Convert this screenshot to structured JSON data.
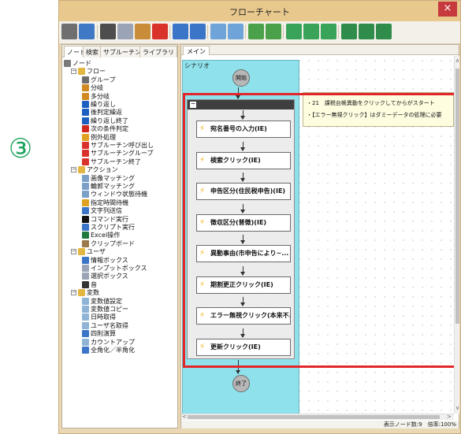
{
  "step_badge": "③",
  "window": {
    "title": "フローチャート",
    "close": "×"
  },
  "toolbar": {
    "buttons": [
      {
        "icon": "new-document-icon",
        "color": "#6f6f6f"
      },
      {
        "icon": "save-icon",
        "color": "#3f79c5"
      },
      {
        "icon": "cut-icon",
        "color": "#4d4d4d"
      },
      {
        "icon": "copy-icon",
        "color": "#9aa4b6"
      },
      {
        "icon": "paste-icon",
        "color": "#c98d3a"
      },
      {
        "icon": "delete-icon",
        "color": "#d9322b"
      },
      {
        "icon": "undo-icon",
        "color": "#3a75c8"
      },
      {
        "icon": "redo-icon",
        "color": "#3a75c8"
      },
      {
        "icon": "zoom-in-icon",
        "color": "#6ea4d8"
      },
      {
        "icon": "zoom-out-icon",
        "color": "#6ea4d8"
      },
      {
        "icon": "image-capture-icon",
        "color": "#4aa14a"
      },
      {
        "icon": "image-edit-icon",
        "color": "#4aa14a"
      },
      {
        "icon": "run-icon",
        "color": "#3aa35a"
      },
      {
        "icon": "export-icon",
        "color": "#3aa35a"
      },
      {
        "icon": "import-icon",
        "color": "#3aa35a"
      },
      {
        "icon": "window-icon",
        "color": "#2f8c4a"
      },
      {
        "icon": "window-import-icon",
        "color": "#2f8c4a"
      },
      {
        "icon": "window-export-icon",
        "color": "#2f8c4a"
      }
    ]
  },
  "left_tabs": [
    "ノード",
    "検索",
    "サブルーチン",
    "ライブラリ"
  ],
  "tree": [
    {
      "label": "ノード",
      "level": 0,
      "expander": "",
      "icon": "node-root-icon",
      "color": "#7a7a7a"
    },
    {
      "label": "フロー",
      "level": 1,
      "expander": "⊟",
      "icon": "folder-icon",
      "color": "#e2b640"
    },
    {
      "label": "グループ",
      "level": 2,
      "expander": "",
      "icon": "group-icon",
      "color": "#6d6d6d"
    },
    {
      "label": "分岐",
      "level": 2,
      "expander": "",
      "icon": "branch-icon",
      "color": "#d08a1f"
    },
    {
      "label": "多分岐",
      "level": 2,
      "expander": "",
      "icon": "multi-branch-icon",
      "color": "#d08a1f"
    },
    {
      "label": "繰り返し",
      "level": 2,
      "expander": "",
      "icon": "loop-icon",
      "color": "#1d5fc0"
    },
    {
      "label": "後判定繰返",
      "level": 2,
      "expander": "",
      "icon": "post-loop-icon",
      "color": "#1d5fc0"
    },
    {
      "label": "繰り返し終了",
      "level": 2,
      "expander": "",
      "icon": "loop-end-icon",
      "color": "#1d5fc0"
    },
    {
      "label": "次の条件判定",
      "level": 2,
      "expander": "",
      "icon": "next-condition-icon",
      "color": "#d0281e"
    },
    {
      "label": "例外処理",
      "level": 2,
      "expander": "",
      "icon": "exception-icon",
      "color": "#e0a020"
    },
    {
      "label": "サブルーチン呼び出し",
      "level": 2,
      "expander": "",
      "icon": "subroutine-call-icon",
      "color": "#d9322b"
    },
    {
      "label": "サブルーチングループ",
      "level": 2,
      "expander": "",
      "icon": "subroutine-group-icon",
      "color": "#d9322b"
    },
    {
      "label": "サブルーチン終了",
      "level": 2,
      "expander": "",
      "icon": "subroutine-end-icon",
      "color": "#d9322b"
    },
    {
      "label": "アクション",
      "level": 1,
      "expander": "⊟",
      "icon": "folder-icon",
      "color": "#e2b640"
    },
    {
      "label": "画像マッチング",
      "level": 2,
      "expander": "",
      "icon": "image-matching-icon",
      "color": "#7aa0c8"
    },
    {
      "label": "輪郭マッチング",
      "level": 2,
      "expander": "",
      "icon": "contour-matching-icon",
      "color": "#7aa0c8"
    },
    {
      "label": "ウィンドウ状態待機",
      "level": 2,
      "expander": "",
      "icon": "window-wait-icon",
      "color": "#7aa0c8"
    },
    {
      "label": "指定時間待機",
      "level": 2,
      "expander": "",
      "icon": "timer-icon",
      "color": "#e0a020"
    },
    {
      "label": "文字列送信",
      "level": 2,
      "expander": "",
      "icon": "text-send-icon",
      "color": "#3a75c8"
    },
    {
      "label": "コマンド実行",
      "level": 2,
      "expander": "",
      "icon": "command-icon",
      "color": "#111111"
    },
    {
      "label": "スクリプト実行",
      "level": 2,
      "expander": "",
      "icon": "script-icon",
      "color": "#3a75c8"
    },
    {
      "label": "Excel操作",
      "level": 2,
      "expander": "",
      "icon": "excel-icon",
      "color": "#1f7a3e"
    },
    {
      "label": "クリップボード",
      "level": 2,
      "expander": "",
      "icon": "clipboard-icon",
      "color": "#9a7a4a"
    },
    {
      "label": "ユーザ",
      "level": 1,
      "expander": "⊟",
      "icon": "folder-icon",
      "color": "#e2b640"
    },
    {
      "label": "情報ボックス",
      "level": 2,
      "expander": "",
      "icon": "info-box-icon",
      "color": "#3a75c8"
    },
    {
      "label": "インプットボックス",
      "level": 2,
      "expander": "",
      "icon": "input-box-icon",
      "color": "#9aa4b6"
    },
    {
      "label": "選択ボックス",
      "level": 2,
      "expander": "",
      "icon": "select-box-icon",
      "color": "#9aa4b6"
    },
    {
      "label": "音",
      "level": 2,
      "expander": "",
      "icon": "sound-icon",
      "color": "#333333"
    },
    {
      "label": "変数",
      "level": 1,
      "expander": "⊟",
      "icon": "folder-icon",
      "color": "#e2b640"
    },
    {
      "label": "変数値設定",
      "level": 2,
      "expander": "",
      "icon": "variable-set-icon",
      "color": "#8fb4d6"
    },
    {
      "label": "変数値コピー",
      "level": 2,
      "expander": "",
      "icon": "variable-copy-icon",
      "color": "#8fb4d6"
    },
    {
      "label": "日時取得",
      "level": 2,
      "expander": "",
      "icon": "datetime-icon",
      "color": "#8fb4d6"
    },
    {
      "label": "ユーザ名取得",
      "level": 2,
      "expander": "",
      "icon": "username-icon",
      "color": "#8fb4d6"
    },
    {
      "label": "四則演算",
      "level": 2,
      "expander": "",
      "icon": "arithmetic-icon",
      "color": "#3a75c8"
    },
    {
      "label": "カウントアップ",
      "level": 2,
      "expander": "",
      "icon": "count-up-icon",
      "color": "#8fb4d6"
    },
    {
      "label": "全角化／半角化",
      "level": 2,
      "expander": "",
      "icon": "width-convert-icon",
      "color": "#3a75c8"
    }
  ],
  "main_tab": "メイン",
  "scenario": {
    "label": "シナリオ",
    "start": "開始",
    "end": "終了",
    "collapse": "−",
    "nodes": [
      "宛名番号の入力(IE)",
      "検索クリック(IE)",
      "申告区分(住民税申告)(IE)",
      "徴収区分(普徴)(IE)",
      "異動事由(市申告により~...",
      "期割更正クリック(IE)",
      "エラー無視クリック(本来不...",
      "更新クリック(IE)"
    ]
  },
  "comment": {
    "line1": "・21　課税台帳異動をクリックしてからがスタート",
    "line2": "・【エラー無視クリック】はダミーデータの処理に必要"
  },
  "scroll": {
    "left": "<",
    "right": ">",
    "up": "∧",
    "down": "∨"
  },
  "status": "表示ノード数:9　倍率:100%",
  "colors": {
    "highlight": "#e3262a",
    "scenario_bg": "#8fe2ec",
    "step_badge": "#1aa35a",
    "title_bar": "#e8c88c",
    "close_button": "#c6393d"
  }
}
